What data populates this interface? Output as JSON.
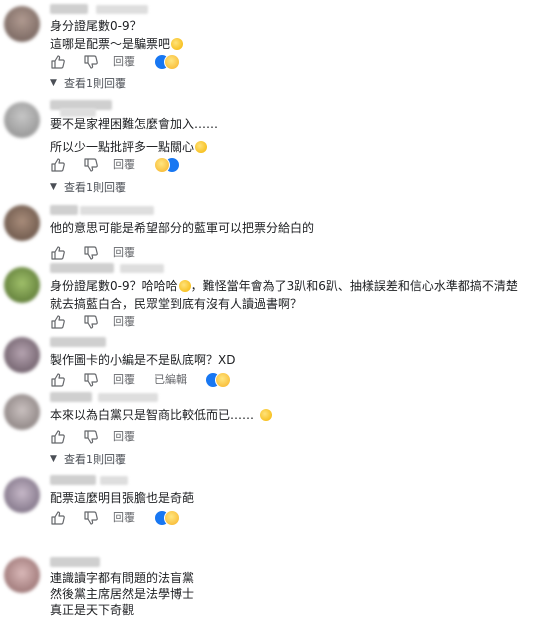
{
  "comments": [
    {
      "lines": [
        "身分證尾數0-9？",
        "這哪是配票～是騙票吧"
      ],
      "reply_label": "回覆",
      "view_replies": "查看1則回覆"
    },
    {
      "lines": [
        "要不是家裡困難怎麼會加入……",
        "所以少一點批評多一點關心"
      ],
      "reply_label": "回覆",
      "view_replies": "查看1則回覆"
    },
    {
      "lines": [
        "他的意思可能是希望部分的藍軍可以把票分給白的"
      ],
      "reply_label": "回覆"
    },
    {
      "lines": [
        "身份證尾數0-9？哈哈哈",
        "，難怪當年會為了3趴和6趴、抽樣誤差和信心水準都搞不清楚",
        "就去搞藍白合，民眾堂到底有沒有人讀過書啊？"
      ],
      "reply_label": "回覆"
    },
    {
      "lines": [
        "製作圖卡的小編是不是臥底啊？XD"
      ],
      "reply_label": "回覆",
      "edited": "已編輯"
    },
    {
      "lines": [
        "本來以為白黨只是智商比較低而已……"
      ],
      "reply_label": "回覆",
      "view_replies": "查看1則回覆"
    },
    {
      "lines": [
        "配票這麼明目張膽也是奇葩"
      ],
      "reply_label": "回覆"
    },
    {
      "lines": [
        "連識讀字都有問題的法盲黨",
        "然後黨主席居然是法學博士",
        "真正是天下奇觀"
      ]
    }
  ],
  "icons": {
    "like": "thumbs-up-icon",
    "dislike": "thumbs-down-icon",
    "chevron": "chevron-down-icon"
  },
  "colors": {
    "like_blue": "#1877f2",
    "haha_yellow": "#f7b125",
    "muted": "#65676b"
  }
}
